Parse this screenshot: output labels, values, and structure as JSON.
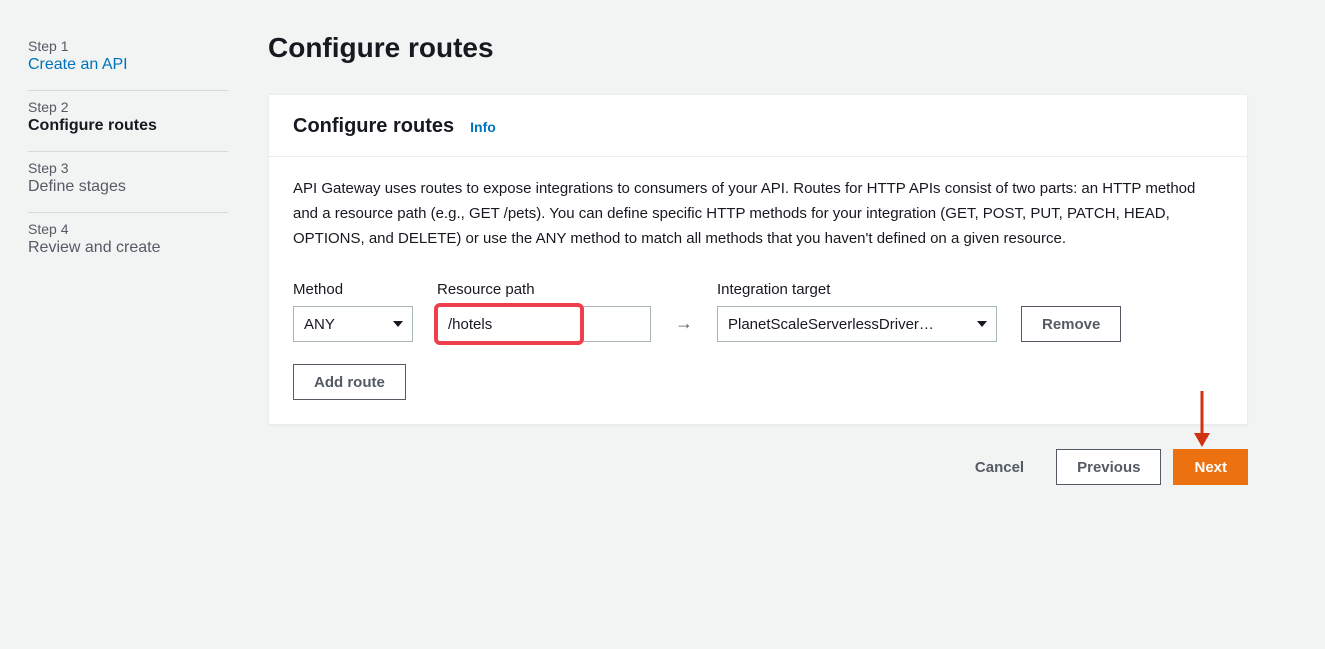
{
  "sidebar": {
    "steps": [
      {
        "label": "Step 1",
        "title": "Create an API",
        "state": "link"
      },
      {
        "label": "Step 2",
        "title": "Configure routes",
        "state": "active"
      },
      {
        "label": "Step 3",
        "title": "Define stages",
        "state": "normal"
      },
      {
        "label": "Step 4",
        "title": "Review and create",
        "state": "normal"
      }
    ]
  },
  "main": {
    "page_title": "Configure routes",
    "panel_heading": "Configure routes",
    "info_label": "Info",
    "description": "API Gateway uses routes to expose integrations to consumers of your API. Routes for HTTP APIs consist of two parts: an HTTP method and a resource path (e.g., GET /pets). You can define specific HTTP methods for your integration (GET, POST, PUT, PATCH, HEAD, OPTIONS, and DELETE) or use the ANY method to match all methods that you haven't defined on a given resource.",
    "route": {
      "method_label": "Method",
      "method_value": "ANY",
      "path_label": "Resource path",
      "path_value": "/hotels",
      "arrow": "→",
      "target_label": "Integration target",
      "target_value": "PlanetScaleServerlessDriver…",
      "remove_label": "Remove"
    },
    "add_route_label": "Add route"
  },
  "footer": {
    "cancel": "Cancel",
    "previous": "Previous",
    "next": "Next"
  }
}
